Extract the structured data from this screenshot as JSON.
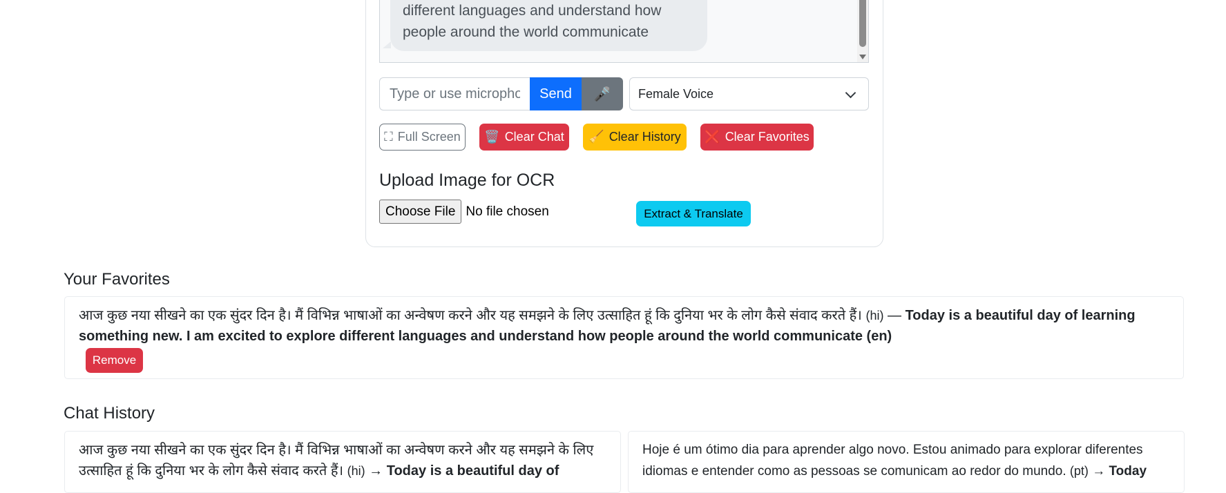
{
  "chat": {
    "bubble_text": "different languages and understand how people around the world communicate"
  },
  "input": {
    "placeholder": "Type or use microphone",
    "send_label": "Send",
    "mic_icon": "🎤"
  },
  "voice": {
    "selected": "Female Voice"
  },
  "buttons": {
    "full_screen_icon": "⛶",
    "full_screen": "Full Screen",
    "clear_chat_icon": "🗑️",
    "clear_chat": "Clear Chat",
    "clear_history_icon": "🧹",
    "clear_history": "Clear History",
    "clear_favorites_icon": "❌",
    "clear_favorites": "Clear Favorites"
  },
  "ocr": {
    "heading": "Upload Image for OCR",
    "choose_file": "Choose File",
    "no_file": "No file chosen",
    "extract_label": "Extract & Translate"
  },
  "favorites": {
    "heading": "Your Favorites",
    "items": [
      {
        "source": "आज कुछ नया सीखने का एक सुंदर दिन है। मैं विभिन्न भाषाओं का अन्वेषण करने और यह समझने के लिए उत्साहित हूं कि दुनिया भर के लोग कैसे संवाद करते हैं।",
        "source_lang": "(hi)",
        "separator": "—",
        "translation": "Today is a beautiful day of learning something new. I am excited to explore different languages and understand how people around the world communicate (en)",
        "remove_label": "Remove"
      }
    ]
  },
  "history": {
    "heading": "Chat History",
    "items": [
      {
        "source": "आज कुछ नया सीखने का एक सुंदर दिन है। मैं विभिन्न भाषाओं का अन्वेषण करने और यह समझने के लिए उत्साहित हूं कि दुनिया भर के लोग कैसे संवाद करते हैं।",
        "source_lang": "(hi)",
        "arrow": "→",
        "translation": "Today is a beautiful day of"
      },
      {
        "source": "Hoje é um ótimo dia para aprender algo novo. Estou animado para explorar diferentes idiomas e entender como as pessoas se comunicam ao redor do mundo.",
        "source_lang": "(pt)",
        "arrow": "→",
        "translation": "Today"
      }
    ]
  }
}
